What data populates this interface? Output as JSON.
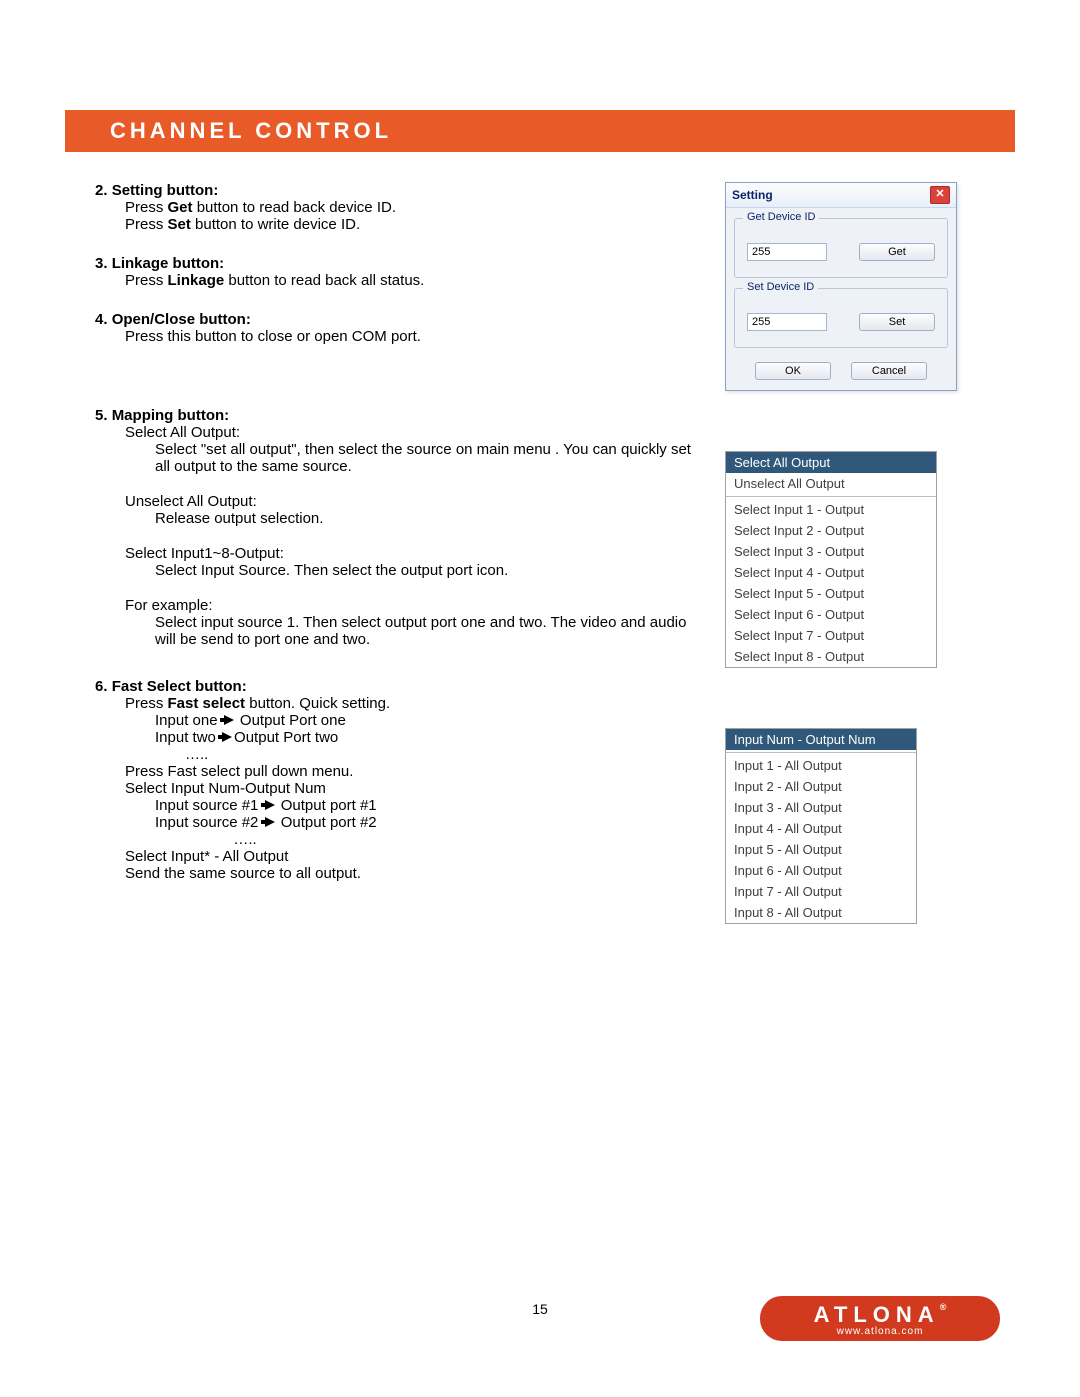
{
  "header": {
    "title": "CHANNEL CONTROL"
  },
  "sections": [
    {
      "num": "2.",
      "title": "Setting button:",
      "lines": [
        {
          "pre": "Press ",
          "bold": "Get",
          "post": " button to read back device ID."
        },
        {
          "pre": "Press ",
          "bold": "Set",
          "post": " button to write device ID."
        }
      ]
    },
    {
      "num": "3.",
      "title": "Linkage button:",
      "lines": [
        {
          "pre": "Press ",
          "bold": "Linkage",
          "post": " button to read back all status."
        }
      ]
    },
    {
      "num": "4.",
      "title": "Open/Close button:",
      "lines": [
        {
          "pre": "",
          "bold": "",
          "post": "Press this button to close or open COM port."
        }
      ]
    }
  ],
  "section5": {
    "num": "5.",
    "title": "Mapping button:",
    "blocks": [
      {
        "head": "Select All Output:",
        "body": "Select \"set all output\", then select the source on main menu . You can quickly set all output to the same source."
      },
      {
        "head": "Unselect All Output:",
        "body": "Release output selection."
      },
      {
        "head": "Select Input1~8-Output:",
        "body": "Select Input Source. Then select the output port icon."
      },
      {
        "head": "For example:",
        "body": "Select input source 1. Then select output port one and two. The video and audio will be send to port one and two."
      }
    ]
  },
  "section6": {
    "num": "6.",
    "title": "Fast Select button:",
    "line1": {
      "pre": "Press ",
      "bold": "Fast select",
      "post": " button. Quick setting."
    },
    "l2": "Input one ",
    "l2b": " Output Port one",
    "l3": "Input two ",
    "l3b": "Output Port two",
    "ell": "…..",
    "l4": "Press Fast select pull down menu.",
    "l5": "Select Input Num-Output Num",
    "l6a": "Input source #1 ",
    "l6b": " Output port #1",
    "l7a": "Input source #2 ",
    "l7b": " Output port #2",
    "l8": "Select Input* - All Output",
    "l9": "Send the same source to all output."
  },
  "setting_dialog": {
    "title": "Setting",
    "group1": {
      "title": "Get Device ID",
      "value": "255",
      "button": "Get"
    },
    "group2": {
      "title": "Set Device ID",
      "value": "255",
      "button": "Set"
    },
    "ok": "OK",
    "cancel": "Cancel"
  },
  "mapping_menu": {
    "selected": "Select All Output",
    "items": [
      "Unselect All Output",
      "Select Input 1 - Output",
      "Select Input 2 - Output",
      "Select Input 3 - Output",
      "Select Input 4 - Output",
      "Select Input 5 - Output",
      "Select Input 6 - Output",
      "Select Input 7 - Output",
      "Select Input 8 - Output"
    ]
  },
  "fast_menu": {
    "selected": "Input Num - Output Num",
    "items": [
      "Input 1 - All Output",
      "Input 2 - All Output",
      "Input 3 - All Output",
      "Input 4 - All Output",
      "Input 5 - All Output",
      "Input 6 - All Output",
      "Input 7 - All Output",
      "Input 8 - All Output"
    ]
  },
  "footer": {
    "page": "15",
    "brand": "ATLONA",
    "reg": "®",
    "url": "www.atlona.com"
  }
}
